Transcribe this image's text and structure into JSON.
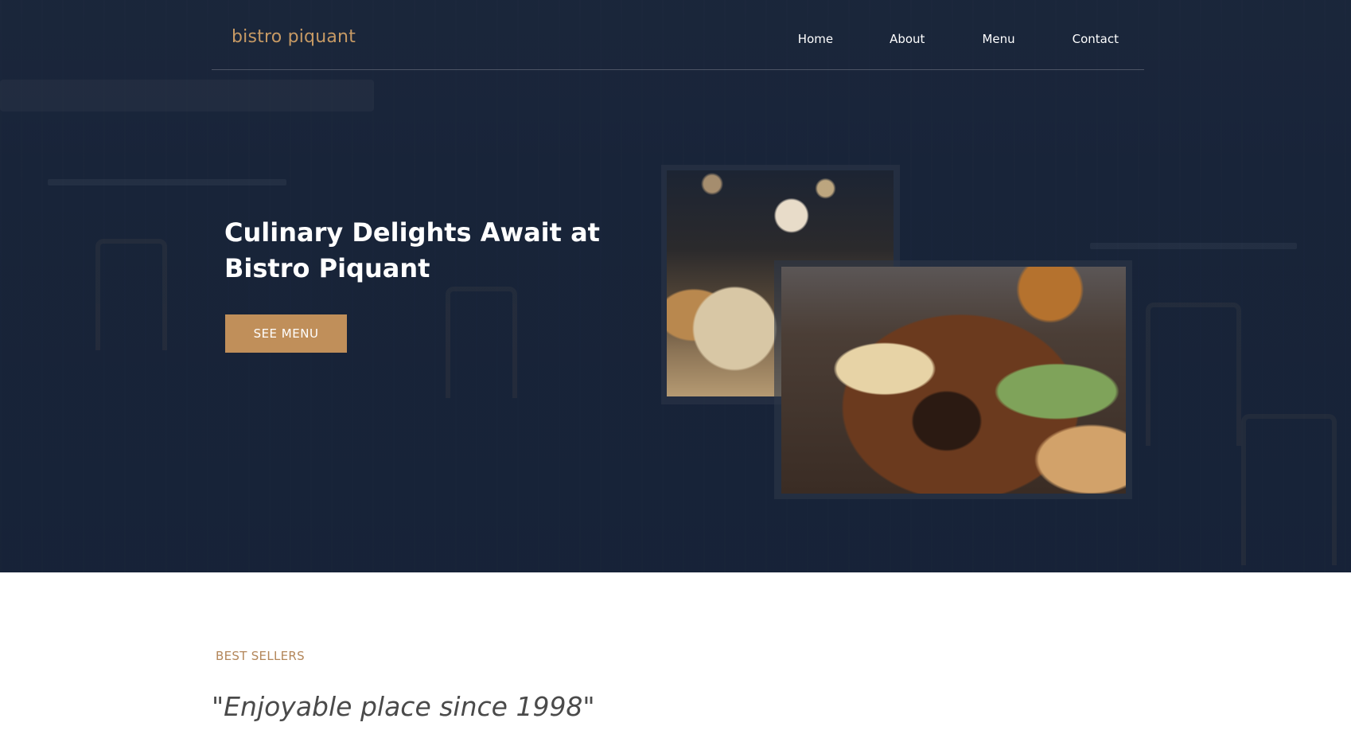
{
  "brand": {
    "name": "bistro piquant",
    "color": "#c79a64"
  },
  "nav": {
    "items": [
      "Home",
      "About",
      "Menu",
      "Contact"
    ]
  },
  "hero": {
    "title": "Culinary Delights Await at Bistro Piquant",
    "cta_label": "SEE MENU",
    "cta_color": "#c08f5a",
    "photos": [
      "dessert-drinks-photo",
      "grilled-platter-photo"
    ]
  },
  "best_sellers": {
    "eyebrow": "BEST SELLERS",
    "quote": "\"Enjoyable place since 1998\""
  }
}
